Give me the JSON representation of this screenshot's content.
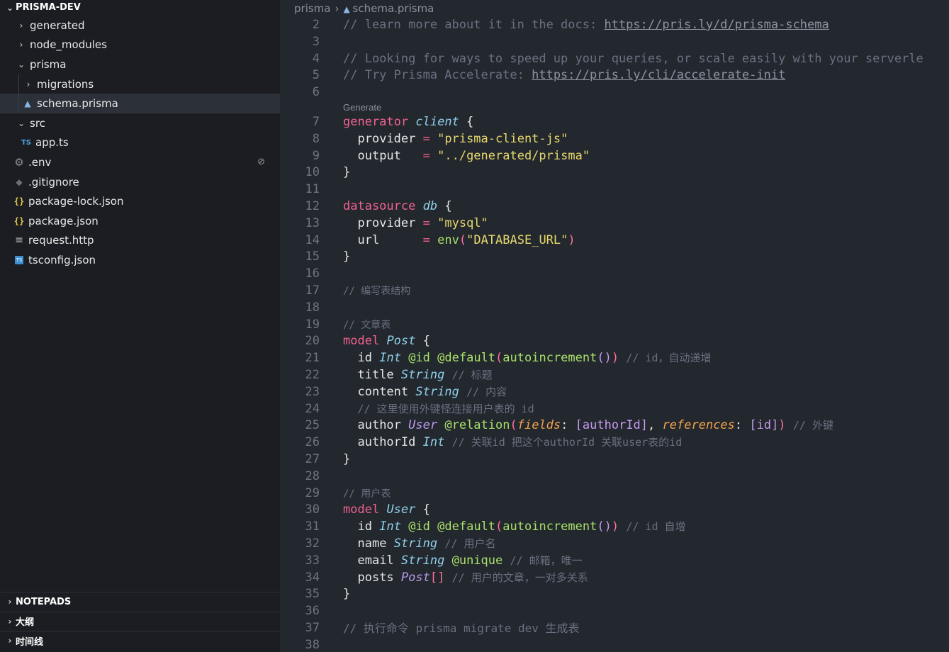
{
  "explorer": {
    "title": "PRISMA-DEV",
    "items": [
      {
        "label": "generated",
        "kind": "folder",
        "expanded": false
      },
      {
        "label": "node_modules",
        "kind": "folder",
        "expanded": false
      },
      {
        "label": "prisma",
        "kind": "folder",
        "expanded": true
      },
      {
        "label": "migrations",
        "kind": "folder",
        "expanded": false
      },
      {
        "label": "schema.prisma",
        "kind": "prisma-file",
        "selected": true
      },
      {
        "label": "src",
        "kind": "folder",
        "expanded": true
      },
      {
        "label": "app.ts",
        "kind": "ts-file",
        "icon_text": "TS"
      },
      {
        "label": ".env",
        "kind": "env-file"
      },
      {
        "label": ".gitignore",
        "kind": "git-file"
      },
      {
        "label": "package-lock.json",
        "kind": "json-file",
        "icon_text": "{}"
      },
      {
        "label": "package.json",
        "kind": "json-file",
        "icon_text": "{}"
      },
      {
        "label": "request.http",
        "kind": "http-file"
      },
      {
        "label": "tsconfig.json",
        "kind": "tsconfig-file",
        "icon_text": "TS"
      }
    ]
  },
  "panels": [
    "NOTEPADS",
    "大纲",
    "时间线"
  ],
  "breadcrumb": {
    "folder": "prisma",
    "file": "schema.prisma"
  },
  "codelens": "Generate",
  "code": {
    "l2": [
      "2",
      "// learn more about it in the docs: ",
      "https://pris.ly/d/prisma-schema"
    ],
    "l3": "3",
    "l4": [
      "4",
      "// Looking for ways to speed up your queries, or scale easily with your serverle"
    ],
    "l5": [
      "5",
      "// Try Prisma Accelerate: ",
      "https://pris.ly/cli/accelerate-init"
    ],
    "l6": "6",
    "l7": [
      "7",
      "generator",
      "client",
      "{"
    ],
    "l8": [
      "8",
      "provider",
      "=",
      "\"prisma-client-js\""
    ],
    "l9": [
      "9",
      "output",
      "=",
      "\"../generated/prisma\""
    ],
    "l10": [
      "10",
      "}"
    ],
    "l11": "11",
    "l12": [
      "12",
      "datasource",
      "db",
      "{"
    ],
    "l13": [
      "13",
      "provider",
      "=",
      "\"mysql\""
    ],
    "l14": [
      "14",
      "url",
      "=",
      "env",
      "(",
      "\"DATABASE_URL\"",
      ")"
    ],
    "l15": [
      "15",
      "}"
    ],
    "l16": "16",
    "l17": [
      "17",
      "// 编写表结构"
    ],
    "l18": "18",
    "l19": [
      "19",
      "// 文章表"
    ],
    "l20": [
      "20",
      "model",
      "Post",
      "{"
    ],
    "l21": [
      "21",
      "id",
      "Int",
      "@id",
      "@default",
      "(",
      "autoincrement",
      "()",
      ")",
      "// id，自动递增"
    ],
    "l22": [
      "22",
      "title",
      "String",
      "// 标题"
    ],
    "l23": [
      "23",
      "content",
      "String",
      "// 内容"
    ],
    "l24": [
      "24",
      "// 这里使用外键怪连接用户表的 id"
    ],
    "l25": [
      "25",
      "author",
      "User",
      "@relation",
      "(",
      "fields",
      ":",
      "[",
      "authorId",
      "]",
      ",",
      "references",
      ":",
      "[",
      "id",
      "]",
      ")",
      "// 外键"
    ],
    "l26": [
      "26",
      "authorId",
      "Int",
      "// 关联id 把这个authorId 关联user表的id"
    ],
    "l27": [
      "27",
      "}"
    ],
    "l28": "28",
    "l29": [
      "29",
      "// 用户表"
    ],
    "l30": [
      "30",
      "model",
      "User",
      "{"
    ],
    "l31": [
      "31",
      "id",
      "Int",
      "@id",
      "@default",
      "(",
      "autoincrement",
      "()",
      ")",
      "// id 自增"
    ],
    "l32": [
      "32",
      "name",
      "String",
      "// 用户名"
    ],
    "l33": [
      "33",
      "email",
      "String",
      "@unique",
      "// 邮箱，唯一"
    ],
    "l34": [
      "34",
      "posts",
      "Post",
      "[]",
      "// 用户的文章，一对多关系"
    ],
    "l35": [
      "35",
      "}"
    ],
    "l36": "36",
    "l37": [
      "37",
      "// 执行命令 prisma migrate dev 生成表"
    ],
    "l38": "38"
  }
}
